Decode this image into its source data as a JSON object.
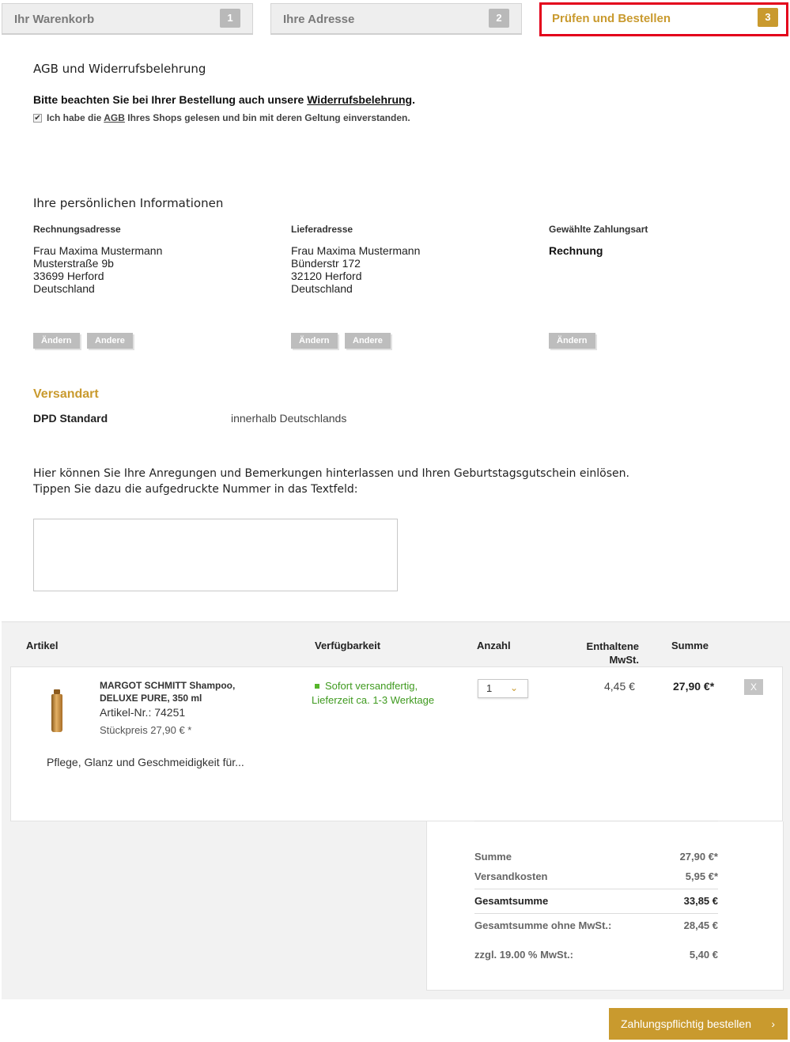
{
  "tabs": [
    {
      "label": "Ihr Warenkorb",
      "num": "1"
    },
    {
      "label": "Ihre Adresse",
      "num": "2"
    },
    {
      "label": "Prüfen und Bestellen",
      "num": "3"
    }
  ],
  "agb": {
    "title": "AGB und Widerrufsbelehrung",
    "note_prefix": "Bitte beachten Sie bei Ihrer Bestellung auch unsere ",
    "note_link": "Widerrufsbelehrung",
    "note_suffix": ".",
    "check_prefix": "Ich habe die ",
    "check_link": "AGB",
    "check_suffix": " Ihres Shops gelesen und bin mit deren Geltung einverstanden.",
    "check_mark": "✔"
  },
  "personal": {
    "title": "Ihre persönlichen Informationen",
    "billing": {
      "heading": "Rechnungsadresse",
      "lines": [
        "Frau Maxima Mustermann",
        "Musterstraße 9b",
        "33699 Herford",
        "Deutschland"
      ]
    },
    "shipping": {
      "heading": "Lieferadresse",
      "lines": [
        "Frau Maxima Mustermann",
        "Bünderstr 172",
        "32120 Herford",
        "Deutschland"
      ]
    },
    "payment": {
      "heading": "Gewählte Zahlungsart",
      "value": "Rechnung"
    },
    "btn_change": "Ändern",
    "btn_other": "Andere"
  },
  "versand": {
    "title": "Versandart",
    "name": "DPD Standard",
    "desc": "innerhalb Deutschlands"
  },
  "comment": {
    "line1": "Hier können Sie Ihre Anregungen und Bemerkungen hinterlassen und Ihren Geburtstagsgutschein einlösen.",
    "line2": "Tippen Sie dazu die aufgedruckte Nummer in das Textfeld:",
    "value": ""
  },
  "cart": {
    "headers": {
      "article": "Artikel",
      "availability": "Verfügbarkeit",
      "qty": "Anzahl",
      "tax_1": "Enthaltene",
      "tax_2": "MwSt.",
      "sum": "Summe"
    },
    "item": {
      "name_1": "MARGOT SCHMITT Shampoo,",
      "name_2": "DELUXE PURE, 350 ml",
      "sku": "Artikel-Nr.: 74251",
      "unit_price": "Stückpreis 27,90 € *",
      "desc": "Pflege, Glanz und Geschmeidigkeit für...",
      "avail_1": "Sofort versandfertig,",
      "avail_2": "Lieferzeit ca. 1-3 Werktage",
      "qty": "1",
      "tax": "4,45 €",
      "sum": "27,90 €*",
      "remove": "X"
    }
  },
  "totals": [
    {
      "label": "Summe",
      "value": "27,90 €*"
    },
    {
      "label": "Versandkosten",
      "value": "5,95 €*"
    },
    {
      "label": "Gesamtsumme",
      "value": "33,85 €"
    },
    {
      "label": "Gesamtsumme ohne MwSt.:",
      "value": "28,45 €"
    },
    {
      "label": "zzgl. 19.00 % MwSt.:",
      "value": "5,40 €"
    }
  ],
  "order_button": {
    "label": "Zahlungspflichtig bestellen",
    "arrow": "›"
  },
  "colors": {
    "accent": "#c99a2e",
    "highlight": "#e3001b",
    "availability": "#3f9a1f"
  }
}
